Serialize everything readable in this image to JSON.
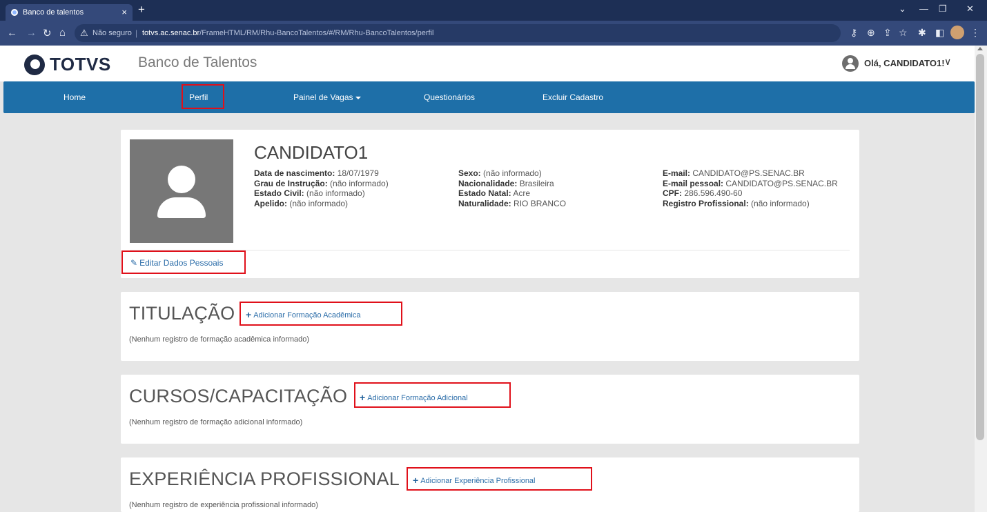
{
  "browser": {
    "tab_title": "Banco de talentos",
    "tab_close": "×",
    "new_tab": "+",
    "not_secure": "Não seguro",
    "url_host": "totvs.ac.senac.br",
    "url_path": "/FrameHTML/RM/Rhu-BancoTalentos/#/RM/Rhu-BancoTalentos/perfil",
    "window_controls": [
      "⌄",
      "—",
      "❐",
      "✕"
    ]
  },
  "header": {
    "logo": "TOTVS",
    "app_title": "Banco de Talentos",
    "greeting": "Olá, CANDIDATO1!"
  },
  "nav": {
    "home": "Home",
    "perfil": "Perfil",
    "painel": "Painel de Vagas",
    "questionarios": "Questionários",
    "excluir": "Excluir Cadastro"
  },
  "profile": {
    "name": "CANDIDATO1",
    "col1": [
      {
        "label": "Data de nascimento:",
        "value": " 18/07/1979"
      },
      {
        "label": "Grau de Instrução:",
        "value": " (não informado)"
      },
      {
        "label": "Estado Civil:",
        "value": " (não informado)"
      },
      {
        "label": "Apelido:",
        "value": " (não informado)"
      }
    ],
    "col2": [
      {
        "label": "Sexo:",
        "value": " (não informado)"
      },
      {
        "label": "Nacionalidade:",
        "value": " Brasileira"
      },
      {
        "label": "Estado Natal:",
        "value": " Acre"
      },
      {
        "label": "Naturalidade:",
        "value": " RIO BRANCO"
      }
    ],
    "col3": [
      {
        "label": "E-mail:",
        "value": " CANDIDATO@PS.SENAC.BR"
      },
      {
        "label": "E-mail pessoal:",
        "value": " CANDIDATO@PS.SENAC.BR"
      },
      {
        "label": "CPF:",
        "value": " 286.596.490-60"
      },
      {
        "label": "Registro Profissional:",
        "value": " (não informado)"
      }
    ],
    "edit_link": "Editar Dados Pessoais"
  },
  "titulacao": {
    "title": "TITULAÇÃO",
    "add_link": "Adicionar Formação Acadêmica",
    "empty": "(Nenhum registro de formação acadêmica informado)"
  },
  "cursos": {
    "title": "CURSOS/CAPACITAÇÃO",
    "add_link": "Adicionar Formação Adicional",
    "empty": "(Nenhum registro de formação adicional informado)"
  },
  "experiencia": {
    "title": "EXPERIÊNCIA PROFISSIONAL",
    "add_link": "Adicionar Experiência Profissional",
    "empty": "(Nenhum registro de experiência profissional informado)"
  },
  "colors": {
    "nav_bg": "#1e6fa8",
    "link": "#2a6ca8",
    "highlight": "#e0101a",
    "browser_bg": "#1d2f55"
  }
}
